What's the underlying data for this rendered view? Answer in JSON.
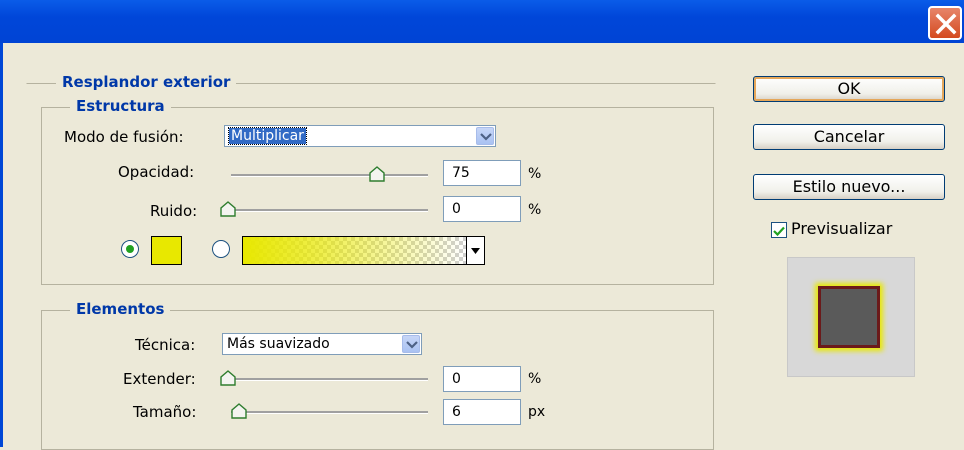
{
  "window": {
    "close_icon": "close-icon"
  },
  "outer_glow": {
    "title": "Resplandor exterior",
    "structure": {
      "title": "Estructura",
      "blend_mode_label": "Modo de fusión:",
      "blend_mode_value": "Multiplicar",
      "opacity_label": "Opacidad:",
      "opacity_value": "75",
      "opacity_unit": "%",
      "opacity_fraction": 0.75,
      "noise_label": "Ruido:",
      "noise_value": "0",
      "noise_unit": "%",
      "glow_color": "#e8e800",
      "gradient_start": "#e8e800"
    },
    "elements": {
      "title": "Elementos",
      "technique_label": "Técnica:",
      "technique_value": "Más suavizado",
      "spread_label": "Extender:",
      "spread_value": "0",
      "spread_unit": "%",
      "size_label": "Tamaño:",
      "size_value": "6",
      "size_unit": "px"
    }
  },
  "buttons": {
    "ok": "OK",
    "cancel": "Cancelar",
    "new_style": "Estilo nuevo..."
  },
  "preview": {
    "label": "Previsualizar",
    "checked": true
  }
}
